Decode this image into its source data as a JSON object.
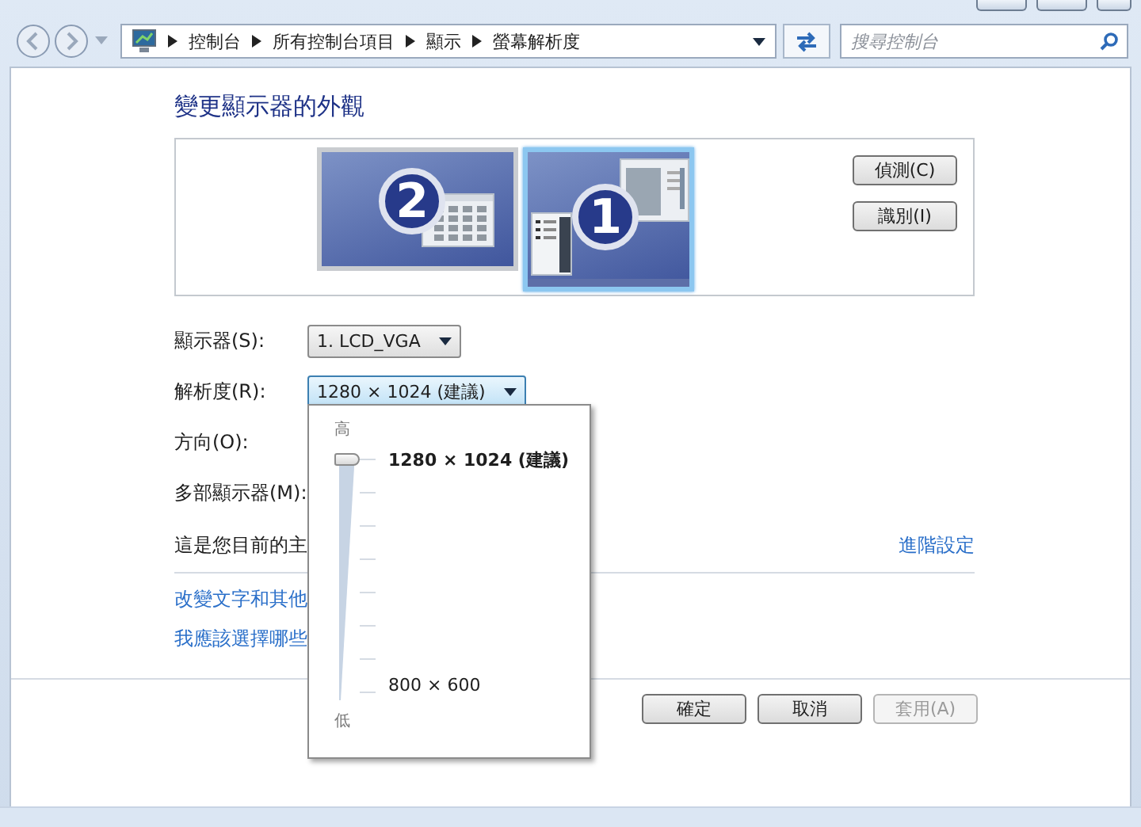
{
  "navigation": {
    "breadcrumb": [
      "控制台",
      "所有控制台項目",
      "顯示",
      "螢幕解析度"
    ],
    "search": {
      "placeholder": "搜尋控制台"
    }
  },
  "heading": "變更顯示器的外觀",
  "monitors": [
    {
      "number": "2",
      "selected": false
    },
    {
      "number": "1",
      "selected": true
    }
  ],
  "monitor_buttons": [
    "偵測(C)",
    "識別(I)"
  ],
  "settings": [
    {
      "label": "顯示器(S):",
      "kind": "dropdown",
      "value": "1. LCD_VGA",
      "focused": false
    },
    {
      "label": "解析度(R):",
      "kind": "dropdown",
      "value": "1280 × 1024 (建議)",
      "focused": true
    },
    {
      "label": "方向(O):",
      "kind": "plain"
    },
    {
      "label": "多部顯示器(M):",
      "kind": "plain"
    }
  ],
  "status_text": "這是您目前的主",
  "advanced_link": "進階設定",
  "links": [
    "改變文字和其他",
    "我應該選擇哪些"
  ],
  "buttons": [
    {
      "label": "確定",
      "disabled": false
    },
    {
      "label": "取消",
      "disabled": false
    },
    {
      "label": "套用(A)",
      "disabled": true
    }
  ],
  "resolution_popup": {
    "high_label": "高",
    "top_option": "1280 × 1024 (建議)",
    "bottom_option": "800 × 600",
    "low_label": "低",
    "level": 1
  }
}
